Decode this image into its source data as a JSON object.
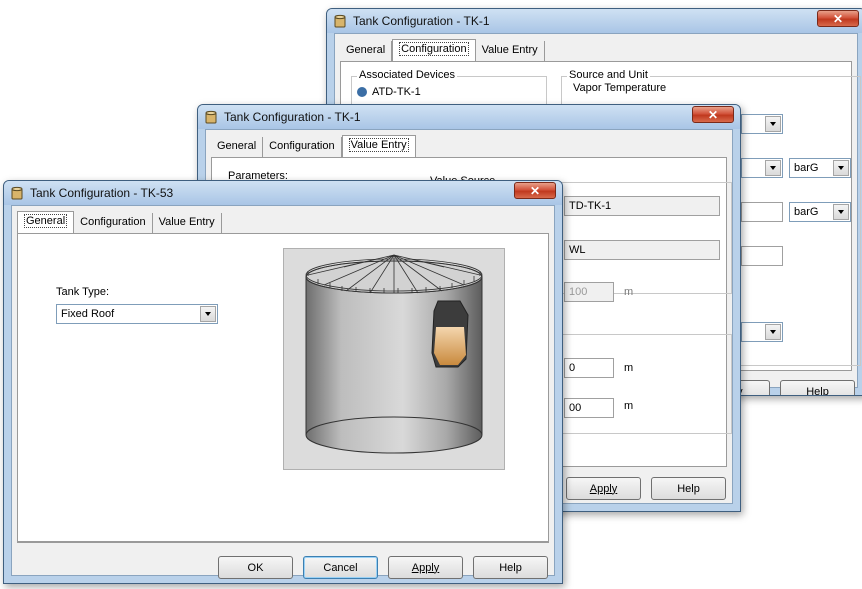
{
  "win_back": {
    "title": "Tank Configuration - TK-1",
    "tabs": [
      "General",
      "Configuration",
      "Value Entry"
    ],
    "assoc_group_label": "Associated Devices",
    "assoc_item": "ATD-TK-1",
    "source_group_label": "Source and Unit",
    "vapor_temp_label": "Vapor Temperature",
    "unit1": "barG",
    "unit2": "barG",
    "btn_apply": "pply",
    "btn_help": "Help"
  },
  "win_mid": {
    "title": "Tank Configuration - TK-1",
    "tabs": [
      "General",
      "Configuration",
      "Value Entry"
    ],
    "parameters_label": "Parameters:",
    "value_source_label": "Value Source",
    "source_value": "TD-TK-1",
    "type_value": "WL",
    "ro_value": "100",
    "unit_m1": "m",
    "val1": "0",
    "unit_m2": "m",
    "val2": "00",
    "unit_m3": "m",
    "btn_apply": "Apply",
    "btn_help": "Help"
  },
  "win_front": {
    "title": "Tank Configuration - TK-53",
    "tabs": [
      "General",
      "Configuration",
      "Value Entry"
    ],
    "tank_type_label": "Tank Type:",
    "tank_type_value": "Fixed Roof",
    "btn_ok": "OK",
    "btn_cancel": "Cancel",
    "btn_apply": "Apply",
    "btn_help": "Help"
  },
  "colors": {
    "frame": "#b9d1ea",
    "close": "#c0391f",
    "client": "#f0f0f0"
  }
}
